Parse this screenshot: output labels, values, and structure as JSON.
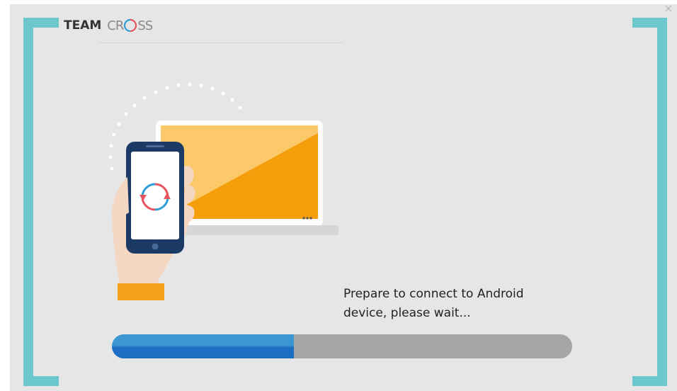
{
  "app": {
    "logo_team": "TEAM",
    "logo_cross_left": "CR",
    "logo_cross_right": "SS",
    "close_glyph": "×"
  },
  "status": {
    "line1": "Prepare to connect to Android",
    "line2": "device, please wait..."
  },
  "progress": {
    "fraction": 0.395
  },
  "colors": {
    "accent_teal": "#6cc8cc",
    "progress_fill": "#1c6ec2",
    "progress_track": "#a6a6a9",
    "screen_orange": "#f59e0b",
    "screen_light": "#fbc86a"
  },
  "icons": {
    "sync": "sync-icon",
    "close": "close-icon"
  }
}
